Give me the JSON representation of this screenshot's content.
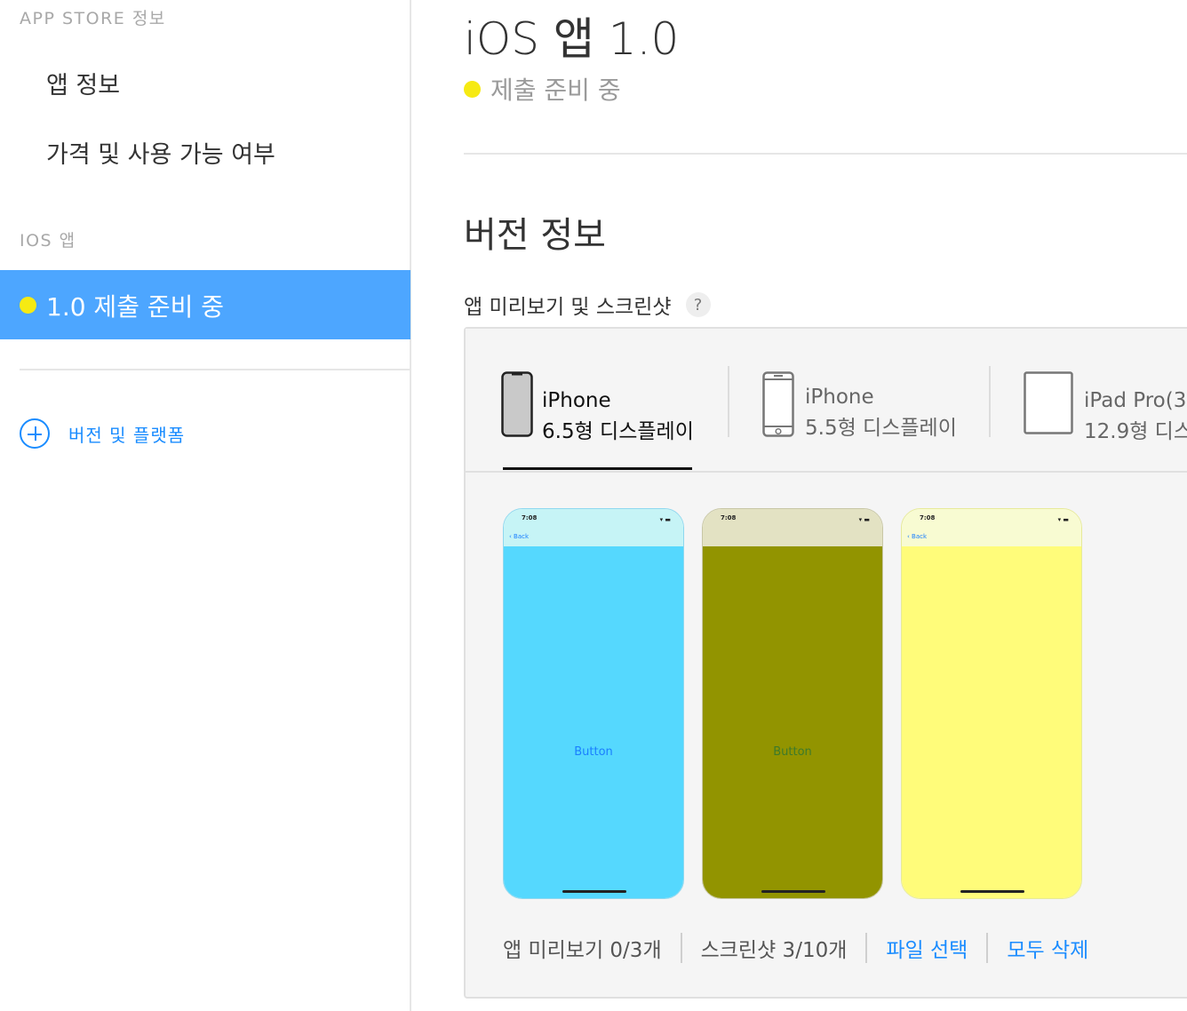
{
  "sidebar": {
    "section1": "APP STORE 정보",
    "item_app_info": "앱 정보",
    "item_pricing": "가격 및 사용 가능 여부",
    "section2": "IOS 앱",
    "active_item": "1.0 제출 준비 중",
    "add_version": "버전 및 플랫폼"
  },
  "main": {
    "title": "iOS 앱 1.0",
    "status": "제출 준비 중",
    "version_info": "버전 정보",
    "preview_heading": "앱 미리보기 및 스크린샷",
    "help": "?",
    "tabs": [
      {
        "line1": "iPhone",
        "line2": "6.5형 디스플레이"
      },
      {
        "line1": "iPhone",
        "line2": "5.5형 디스플레이"
      },
      {
        "line1": "iPad Pro(3",
        "line2": "12.9형 디스"
      }
    ],
    "screenshots": [
      {
        "time": "7:08",
        "back": "Back",
        "button": "Button",
        "status_color": "#c6f4f6",
        "body_color": "#55d8fe",
        "button_color": "#1a7fff"
      },
      {
        "time": "7:08",
        "back": "",
        "button": "Button",
        "status_color": "#e3e2c3",
        "body_color": "#929400",
        "button_color": "#3d7a2a"
      },
      {
        "time": "7:08",
        "back": "Back",
        "button": "",
        "status_color": "#f8fbd2",
        "body_color": "#fffc7a",
        "button_color": "#1a7fff"
      }
    ],
    "footer": {
      "previews": "앱 미리보기 0/3개",
      "screenshots": "스크린샷 3/10개",
      "choose_file": "파일 선택",
      "delete_all": "모두 삭제"
    }
  },
  "colors": {
    "accent": "#1a8cff",
    "sidebar_active": "#4da6ff",
    "status_dot": "#f6ea13"
  }
}
